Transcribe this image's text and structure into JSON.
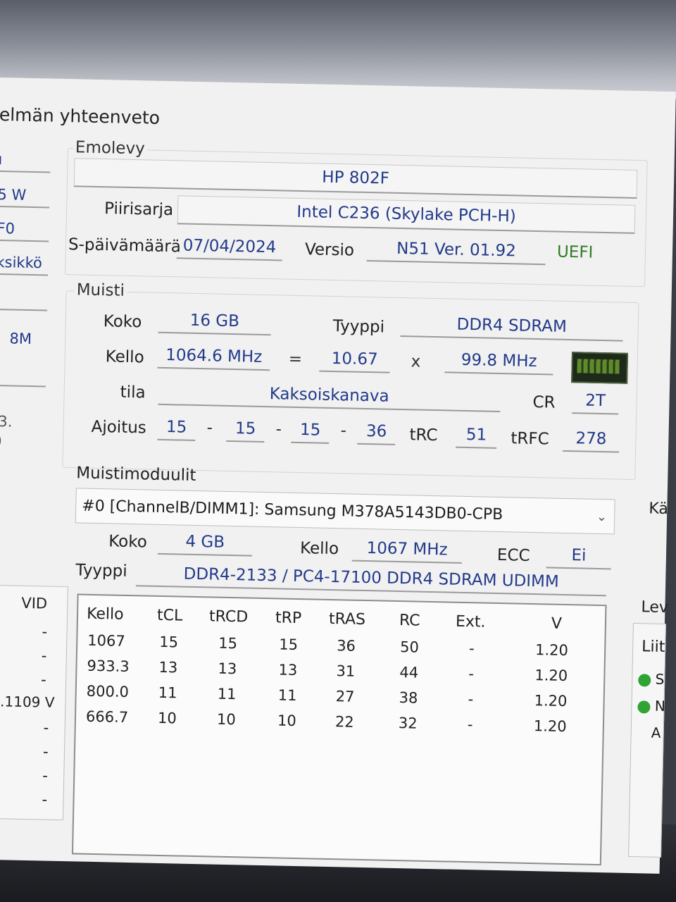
{
  "window": {
    "title": "elmän yhteenveto"
  },
  "left_column": {
    "cells": [
      "ı",
      "5 W",
      "F0",
      "ksikkö",
      "",
      "8M",
      "",
      "-3.",
      "0"
    ],
    "vid_header": "VID",
    "vid_values": [
      "-",
      "-",
      "-",
      "1.1109 V",
      "-",
      "-",
      "-",
      "-"
    ]
  },
  "motherboard": {
    "group_label": "Emolevy",
    "model": "HP 802F",
    "chipset_label": "Piirisarja",
    "chipset_value": "Intel C236 (Skylake PCH-H)",
    "bios_date_label": "S-päivämäärä",
    "bios_date_value": "07/04/2024",
    "version_label": "Versio",
    "version_value": "N51 Ver. 01.92",
    "uefi_label": "UEFI"
  },
  "memory": {
    "group_label": "Muisti",
    "size_label": "Koko",
    "size_value": "16 GB",
    "type_label": "Tyyppi",
    "type_value": "DDR4 SDRAM",
    "clock_label": "Kello",
    "clock_value": "1064.6 MHz",
    "equals": "=",
    "multiplier": "10.67",
    "times": "x",
    "bus": "99.8 MHz",
    "mode_label": "tila",
    "mode_value": "Kaksoiskanava",
    "cr_label": "CR",
    "cr_value": "2T",
    "timing_label": "Ajoitus",
    "timings": [
      "15",
      "15",
      "15",
      "36"
    ],
    "dash": "-",
    "trc_label": "tRC",
    "trc_value": "51",
    "trfc_label": "tRFC",
    "trfc_value": "278"
  },
  "modules": {
    "group_label": "Muistimoduulit",
    "selected": "#0 [ChannelB/DIMM1]: Samsung M378A5143DB0-CPB",
    "size_label": "Koko",
    "size_value": "4 GB",
    "clock_label": "Kello",
    "clock_value": "1067 MHz",
    "ecc_label": "ECC",
    "ecc_value": "Ei",
    "type_label": "Tyyppi",
    "type_value": "DDR4-2133 / PC4-17100 DDR4 SDRAM UDIMM",
    "table": {
      "headers": [
        "Kello",
        "tCL",
        "tRCD",
        "tRP",
        "tRAS",
        "RC",
        "Ext.",
        "V"
      ],
      "rows": [
        [
          "1067",
          "15",
          "15",
          "15",
          "36",
          "50",
          "-",
          "1.20"
        ],
        [
          "933.3",
          "13",
          "13",
          "13",
          "31",
          "44",
          "-",
          "1.20"
        ],
        [
          "800.0",
          "11",
          "11",
          "11",
          "27",
          "38",
          "-",
          "1.20"
        ],
        [
          "666.7",
          "10",
          "10",
          "10",
          "22",
          "32",
          "-",
          "1.20"
        ]
      ]
    }
  },
  "right_column": {
    "labels": [
      "Kä",
      "Lev",
      "Liit",
      "S",
      "N",
      "A"
    ]
  }
}
